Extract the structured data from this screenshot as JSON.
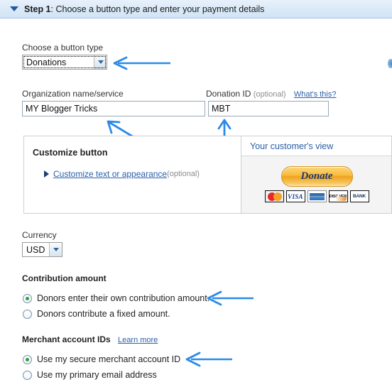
{
  "header": {
    "triangle_icon": "triangle-down-icon",
    "step_prefix": "Step 1",
    "title_rest": ": Choose a button type and enter your payment details",
    "full_title": "Step 1: Choose a button type and enter your payment details"
  },
  "button_type": {
    "label": "Choose a button type",
    "selected": "Donations",
    "options": [
      "Donations"
    ]
  },
  "organization": {
    "label": "Organization name/service",
    "value": "MY Blogger Tricks",
    "placeholder": ""
  },
  "donation_id": {
    "label": "Donation ID",
    "optional": "(optional)",
    "help_link": "What's this?",
    "value": "MBT",
    "placeholder": ""
  },
  "customize": {
    "title": "Customize button",
    "link": "Customize text or appearance",
    "optional": "(optional)",
    "arrow_icon": "triangle-right-icon"
  },
  "customer_view": {
    "title": "Your customer's view",
    "donate_button": "Donate",
    "cards": [
      {
        "name": "mastercard-logo",
        "text": ""
      },
      {
        "name": "visa-logo",
        "text": "VISA"
      },
      {
        "name": "amex-logo",
        "text": ""
      },
      {
        "name": "discover-logo",
        "text": "DISC VER"
      },
      {
        "name": "bank-logo",
        "text": "BANK"
      }
    ]
  },
  "currency": {
    "label": "Currency",
    "selected": "USD",
    "options": [
      "USD"
    ]
  },
  "contribution": {
    "label": "Contribution amount",
    "options": [
      {
        "label": "Donors enter their own contribution amount.",
        "checked": true
      },
      {
        "label": "Donors contribute a fixed amount.",
        "checked": false
      }
    ]
  },
  "merchant": {
    "label": "Merchant account IDs",
    "learn_more": "Learn more",
    "options": [
      {
        "label": "Use my secure merchant account ID",
        "checked": true
      },
      {
        "label": "Use my primary email address",
        "checked": false
      }
    ]
  },
  "colors": {
    "accent_blue": "#2b5fa8",
    "annotation_blue": "#2a8ae8",
    "header_bg": "#dbeaf8",
    "radio_green": "#2f9e44",
    "donate_orange": "#f1a21d"
  },
  "annotations": [
    {
      "name": "arrow-to-button-type-select",
      "direction": "left"
    },
    {
      "name": "arrow-to-organization-field",
      "direction": "up-left"
    },
    {
      "name": "arrow-to-donation-id-field",
      "direction": "up"
    },
    {
      "name": "arrow-to-contribution-option",
      "direction": "left"
    },
    {
      "name": "arrow-to-merchant-option",
      "direction": "left"
    }
  ]
}
